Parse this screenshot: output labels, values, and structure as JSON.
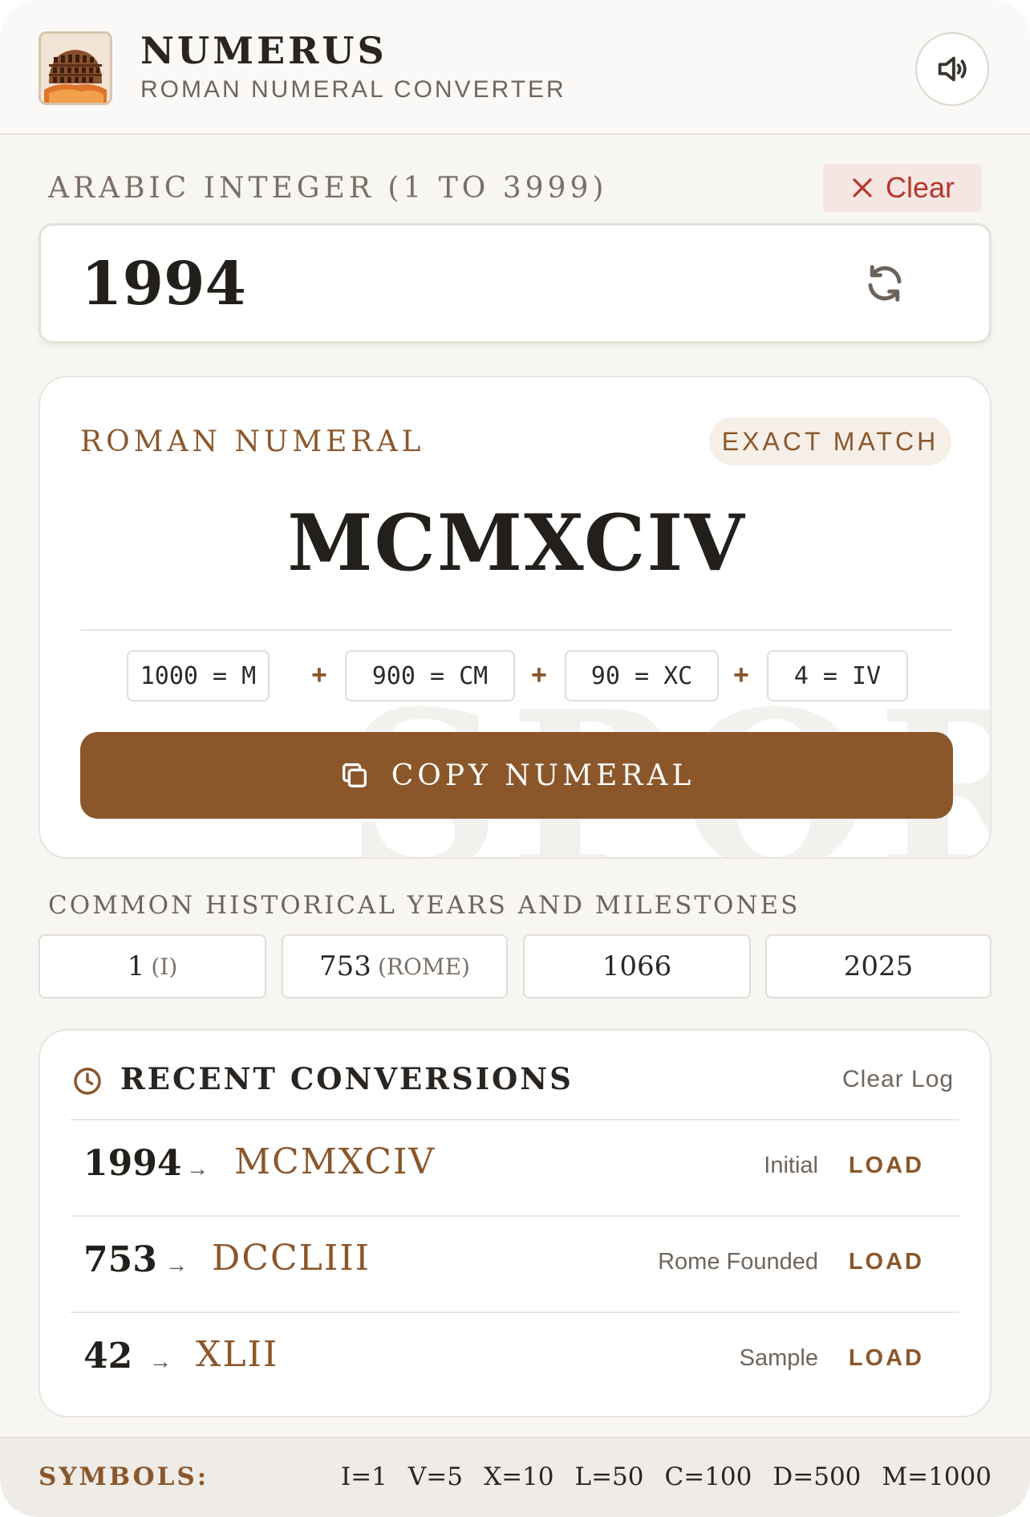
{
  "header": {
    "title": "NUMERUS",
    "subtitle": "ROMAN NUMERAL CONVERTER"
  },
  "input": {
    "label": "ARABIC INTEGER (1 TO 3999)",
    "clear_label": "Clear",
    "value": "1994"
  },
  "result": {
    "label": "ROMAN NUMERAL",
    "badge": "EXACT MATCH",
    "numeral": "MCMXCIV",
    "breakdown": [
      "1000 = M",
      "900 = CM",
      "90 = XC",
      "4 = IV"
    ],
    "plus": "+",
    "copy_label": "COPY NUMERAL",
    "watermark": "SPQR"
  },
  "years": {
    "label": "COMMON HISTORICAL YEARS AND MILESTONES",
    "items": [
      {
        "value": "1",
        "note": "(I)"
      },
      {
        "value": "753",
        "note": "(ROME)"
      },
      {
        "value": "1066",
        "note": ""
      },
      {
        "value": "2025",
        "note": ""
      }
    ]
  },
  "recent": {
    "title": "RECENT CONVERSIONS",
    "clear_log": "Clear Log",
    "arrow": "→",
    "load_label": "LOAD",
    "rows": [
      {
        "arabic": "1994",
        "roman": "MCMXCIV",
        "note": "Initial"
      },
      {
        "arabic": "753",
        "roman": "DCCLIII",
        "note": "Rome Founded"
      },
      {
        "arabic": "42",
        "roman": "XLII",
        "note": "Sample"
      }
    ]
  },
  "footer": {
    "label": "SYMBOLS:",
    "symbols": [
      "I=1",
      "V=5",
      "X=10",
      "L=50",
      "C=100",
      "D=500",
      "M=1000"
    ]
  },
  "colors": {
    "accent": "#8b572a",
    "danger": "#b5382c",
    "text": "#231f1b",
    "background": "#f8f6f3"
  },
  "icons": {
    "logo": "colosseum-icon",
    "sound": "speaker-icon",
    "clear": "close-icon",
    "refresh": "refresh-icon",
    "copy": "copy-icon",
    "recent": "clock-icon"
  }
}
